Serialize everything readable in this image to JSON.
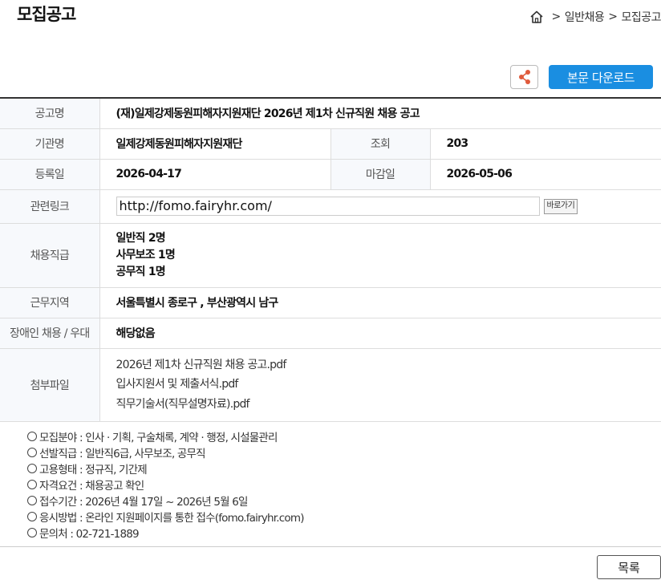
{
  "page_title": "모집공고",
  "breadcrumb": {
    "home_icon": "home-icon",
    "separator": ">",
    "items": [
      "일반채용",
      "모집공고"
    ]
  },
  "actions": {
    "share_icon": "share-icon",
    "download_label": "본문 다운로드",
    "download_color": "#1a8ee1"
  },
  "info": {
    "title_label": "공고명",
    "title_value": "(재)일제강제동원피해자지원재단 2026년 제1차 신규직원 채용 공고",
    "org_label": "기관명",
    "org_value": "일제강제동원피해자지원재단",
    "views_label": "조회",
    "views_value": "203",
    "reg_label": "등록일",
    "reg_value": "2026-04-17",
    "deadline_label": "마감일",
    "deadline_value": "2026-05-06",
    "link_label": "관련링크",
    "link_value": "http://fomo.fairyhr.com/",
    "link_button": "바로가기",
    "positions_label": "채용직급",
    "positions": [
      "일반직 2명",
      "사무보조 1명",
      "공무직 1명"
    ],
    "region_label": "근무지역",
    "region_value": "서울특별시 종로구 , 부산광역시 남구",
    "disability_label": "장애인 채용 / 우대",
    "disability_value": "해당없음",
    "files_label": "첨부파일",
    "files": [
      "2026년 제1차 신규직원 채용 공고.pdf",
      "입사지원서 및 제출서식.pdf",
      "직무기술서(직무설명자료).pdf"
    ]
  },
  "notice": [
    "모집분야 : 인사 · 기획, 구술채록, 계약 · 행정, 시설물관리",
    "선발직급 : 일반직6급, 사무보조, 공무직",
    "고용형태 : 정규직, 기간제",
    "자격요건 : 채용공고 확인",
    "접수기간 : 2026년 4월 17일 ~ 2026년 5월 6일",
    "응시방법 : 온라인 지원페이지를 통한 접수(fomo.fairyhr.com)",
    "문의처 : 02-721-1889"
  ],
  "list_button": "목록"
}
